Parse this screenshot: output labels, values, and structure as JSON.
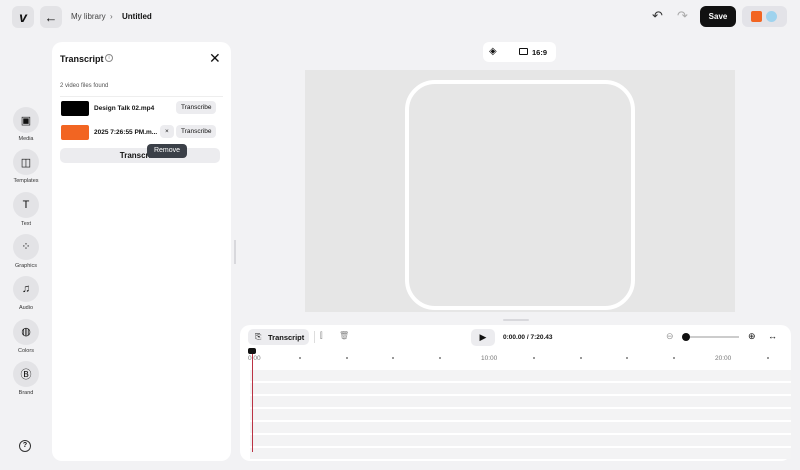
{
  "header": {
    "breadcrumb_root": "My library",
    "breadcrumb_current": "Untitled",
    "save_label": "Save"
  },
  "rail": [
    {
      "label": "Media",
      "icon": "▣"
    },
    {
      "label": "Templates",
      "icon": "◫"
    },
    {
      "label": "Text",
      "icon": "T"
    },
    {
      "label": "Graphics",
      "icon": "⁘"
    },
    {
      "label": "Audio",
      "icon": "♫"
    },
    {
      "label": "Colors",
      "icon": "◍"
    },
    {
      "label": "Brand",
      "icon": "Ⓑ"
    }
  ],
  "help_icon": "?",
  "transcript": {
    "title": "Transcript",
    "found": "2 video files found",
    "files": [
      {
        "name": "Design Talk 02.mp4",
        "action": "Transcribe"
      },
      {
        "name": "2025 7:26:55 PM.m...",
        "action": "Transcribe",
        "remove": "×"
      }
    ],
    "transcribe_all": "Transcribe",
    "tooltip": "Remove"
  },
  "canvas": {
    "aspect": "16:9"
  },
  "timeline": {
    "transcript_label": "Transcript",
    "time": "0:00.00 / 7:20.43",
    "ticks": [
      "0:00",
      "10:00",
      "20:00"
    ],
    "zoom_level": 0
  }
}
